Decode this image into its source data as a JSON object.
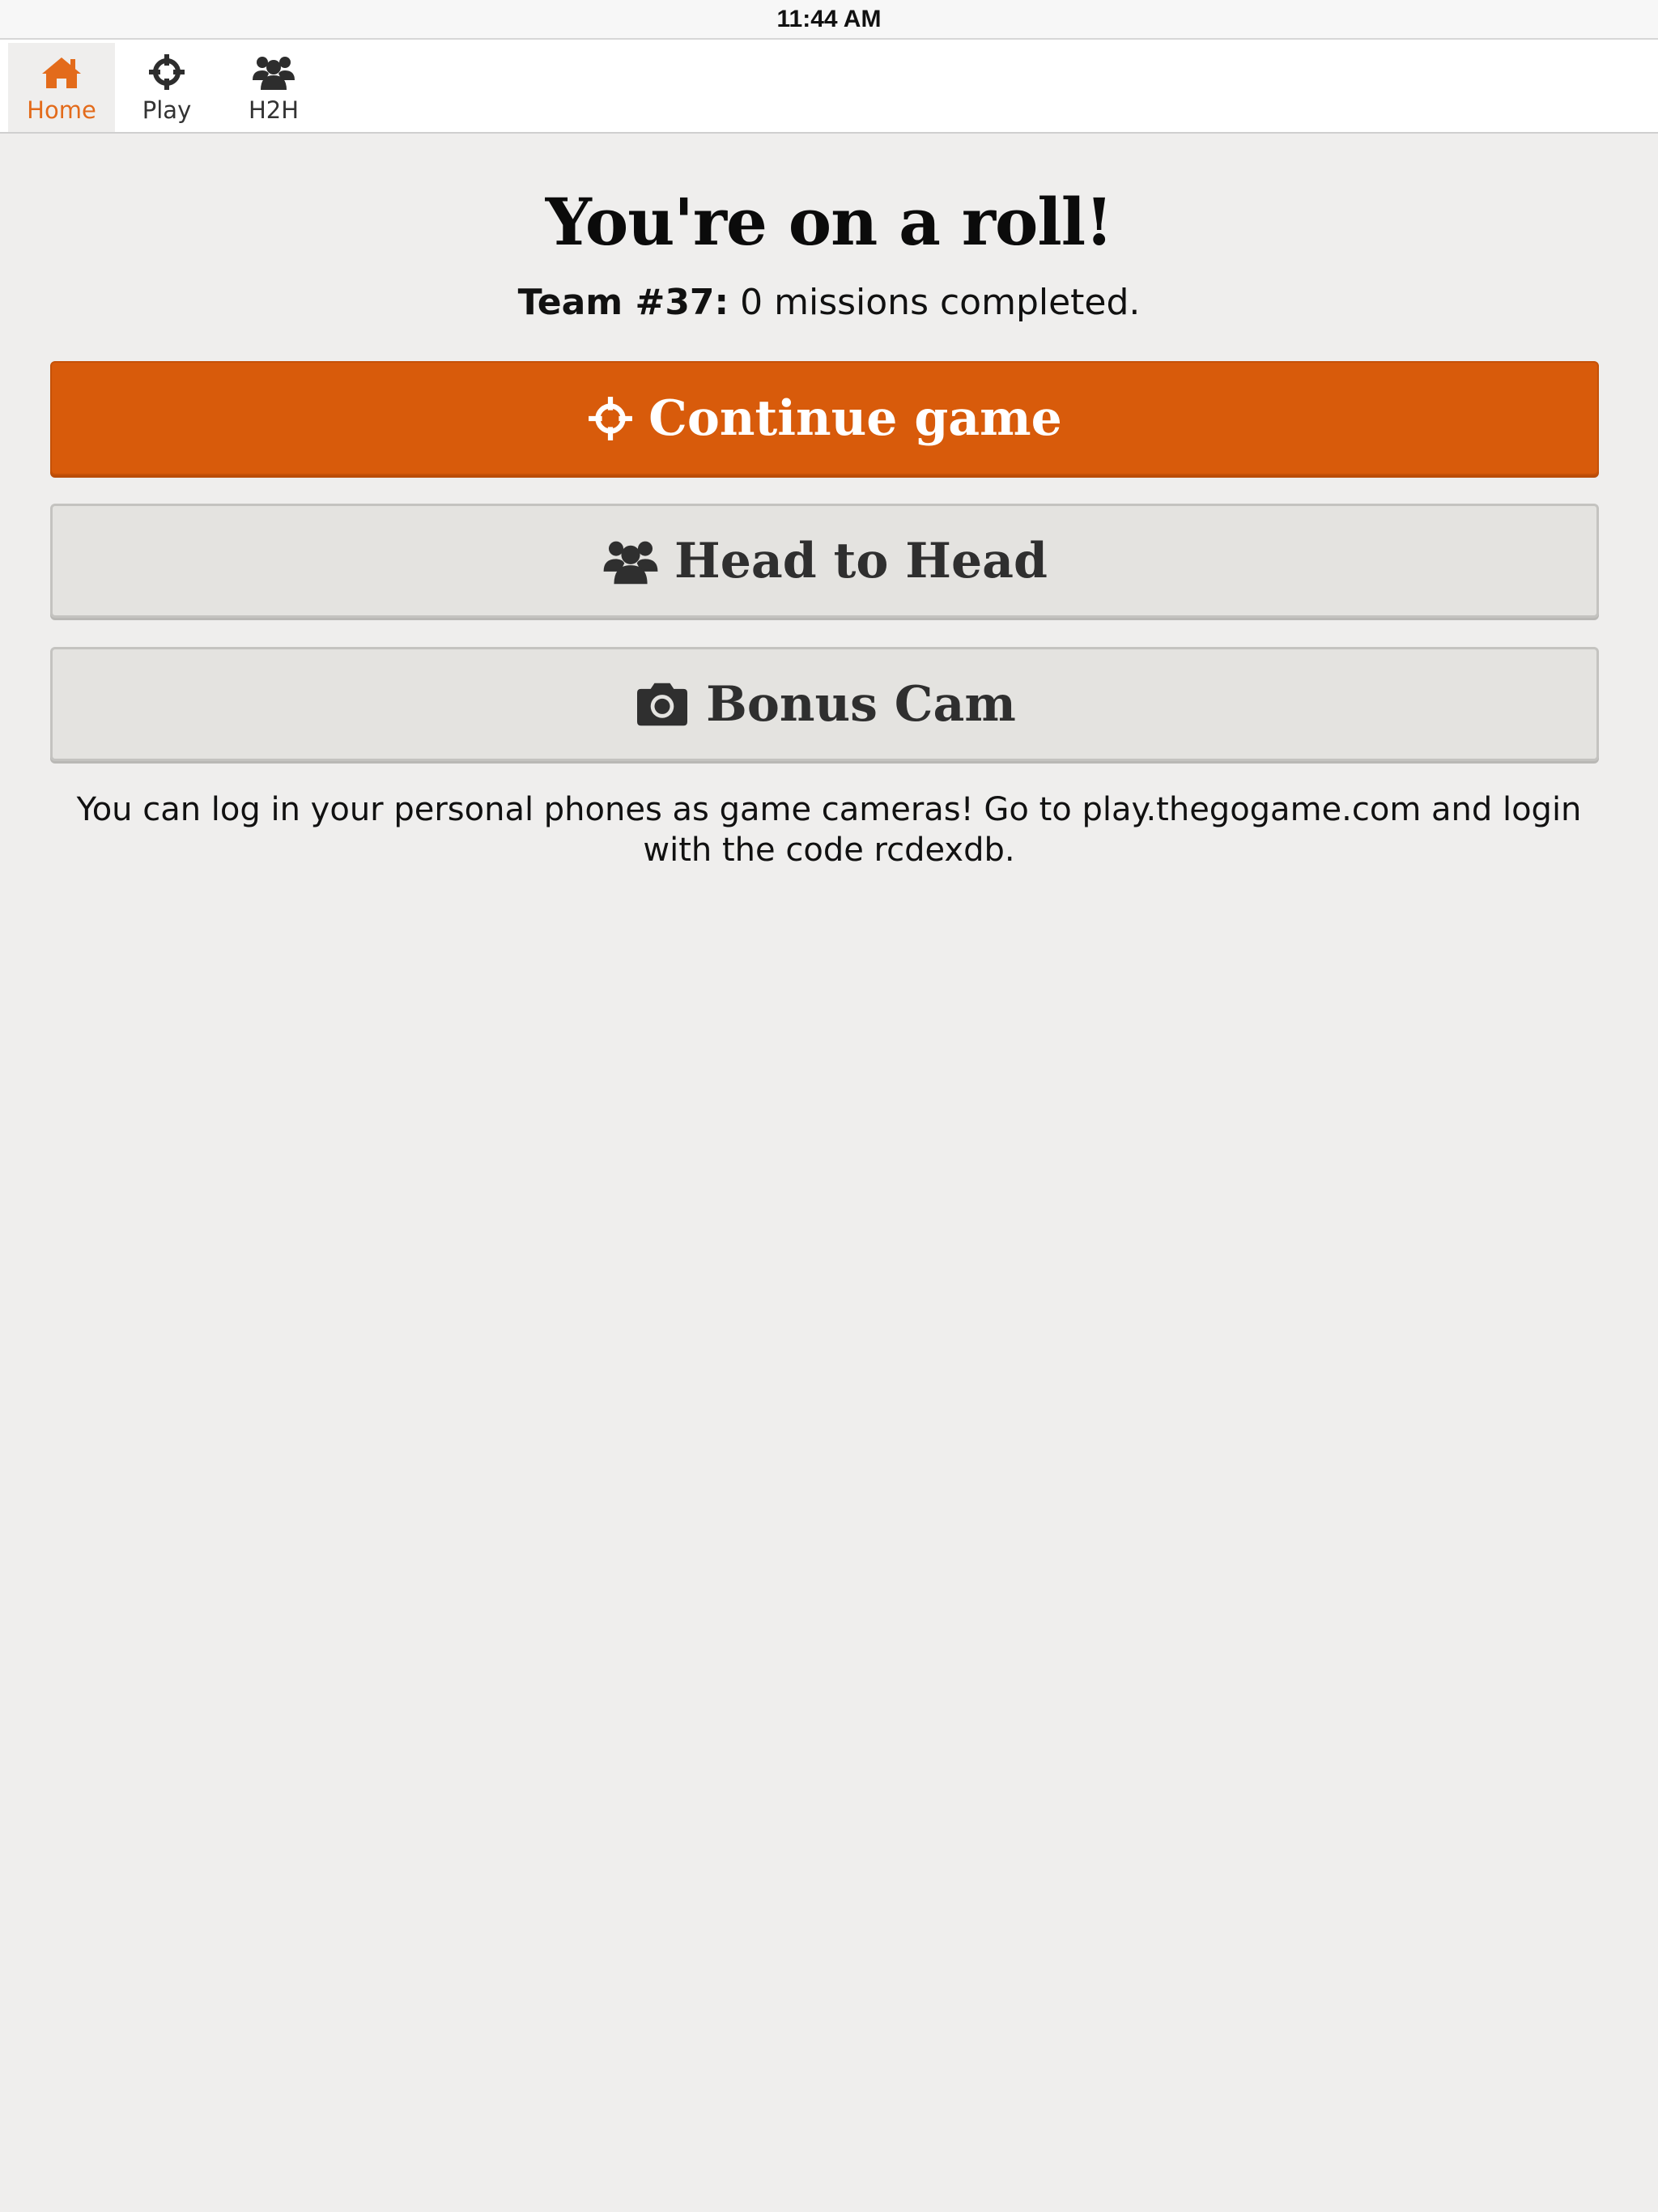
{
  "status_bar": {
    "time": "11:44 AM"
  },
  "tabs": [
    {
      "label": "Home",
      "icon": "home-icon",
      "active": true
    },
    {
      "label": "Play",
      "icon": "crosshairs-icon",
      "active": false
    },
    {
      "label": "H2H",
      "icon": "group-icon",
      "active": false
    }
  ],
  "main": {
    "headline": "You're on a roll!",
    "team_label": "Team #37:",
    "missions_text": " 0 missions completed.",
    "continue_label": "Continue game",
    "head_to_head_label": "Head to Head",
    "bonus_cam_label": "Bonus Cam",
    "info_text": "You can log in your personal phones as game cameras! Go to play.thegogame.com and login with the code rcdexdb."
  },
  "colors": {
    "accent": "#d85b0b",
    "active_tab_text": "#e36b1b",
    "background": "#efeeed",
    "secondary_button": "#e4e3e0"
  }
}
